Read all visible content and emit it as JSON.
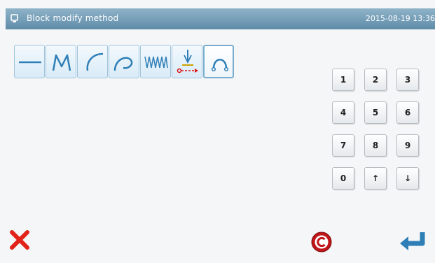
{
  "titlebar": {
    "icon": "screen-icon",
    "title": "Block modify method",
    "datetime": "2015-08-19 13:36"
  },
  "methods": [
    {
      "name": "straight-line",
      "icon": "straight-line-icon"
    },
    {
      "name": "zigzag",
      "icon": "zigzag-icon"
    },
    {
      "name": "arc",
      "icon": "arc-icon"
    },
    {
      "name": "curve",
      "icon": "curve-icon"
    },
    {
      "name": "zigzag-sewing",
      "icon": "zigzag-sewing-icon"
    },
    {
      "name": "feed",
      "icon": "needle-feed-icon"
    },
    {
      "name": "point-arc",
      "icon": "point-arc-icon",
      "selected": true
    }
  ],
  "keypad": {
    "keys": [
      "1",
      "2",
      "3",
      "4",
      "5",
      "6",
      "7",
      "8",
      "9",
      "0",
      "↑",
      "↓"
    ]
  },
  "footer": {
    "cancel_icon": "red-x-icon",
    "clear_icon": "clear-c-icon",
    "enter_icon": "enter-arrow-icon"
  },
  "colors": {
    "titlebar": "#6f98b4",
    "button_border": "#9fc4dc",
    "icon_blue": "#2f7fb7",
    "cancel_red": "#e2231a",
    "clear_red": "#c0161a"
  }
}
